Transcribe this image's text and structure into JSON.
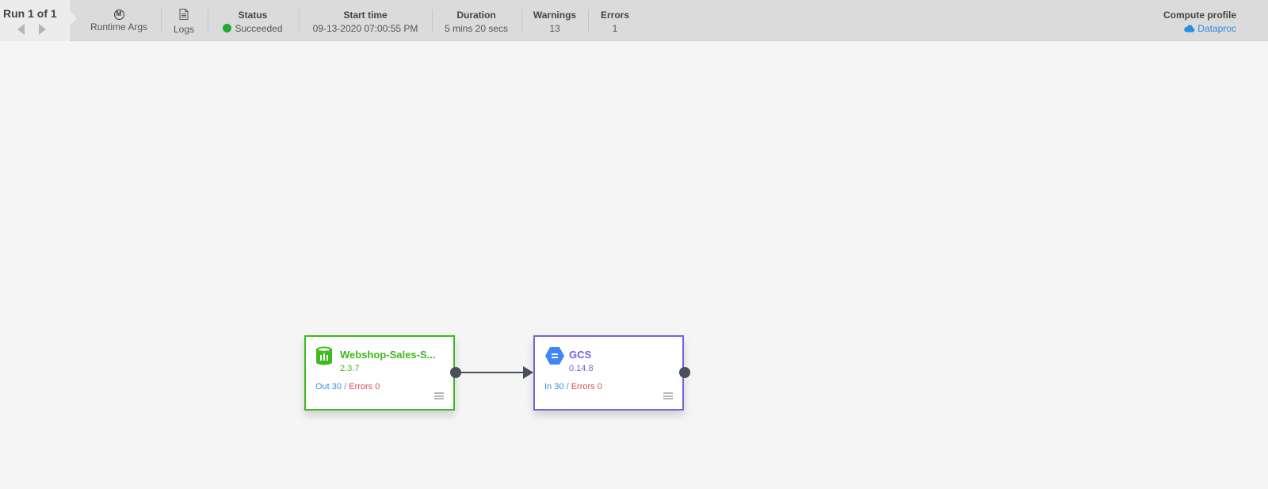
{
  "run": {
    "title": "Run 1 of 1"
  },
  "runtime_args": {
    "label": "Runtime Args",
    "icon": "m-circle-icon"
  },
  "logs": {
    "label": "Logs",
    "icon": "document-icon"
  },
  "status": {
    "header": "Status",
    "value": "Succeeded",
    "color": "#22a830"
  },
  "start_time": {
    "header": "Start time",
    "value": "09-13-2020 07:00:55 PM"
  },
  "duration": {
    "header": "Duration",
    "value": "5 mins 20 secs"
  },
  "warnings": {
    "header": "Warnings",
    "value": "13"
  },
  "errors": {
    "header": "Errors",
    "value": "1"
  },
  "compute_profile": {
    "header": "Compute profile",
    "value": "Dataproc",
    "icon": "cloud-icon"
  },
  "nodes": [
    {
      "name": "Webshop-Sales-S...",
      "version": "2.3.7",
      "metric_label": "Out",
      "metric_value": "30",
      "separator": "/",
      "errors_label": "Errors",
      "errors_value": "0",
      "icon": "database-icon",
      "color": "#3cba1e"
    },
    {
      "name": "GCS",
      "version": "0.14.8",
      "metric_label": "In",
      "metric_value": "30",
      "separator": "/",
      "errors_label": "Errors",
      "errors_value": "0",
      "icon": "gcs-hexagon-icon",
      "color": "#7b5fd9"
    }
  ]
}
